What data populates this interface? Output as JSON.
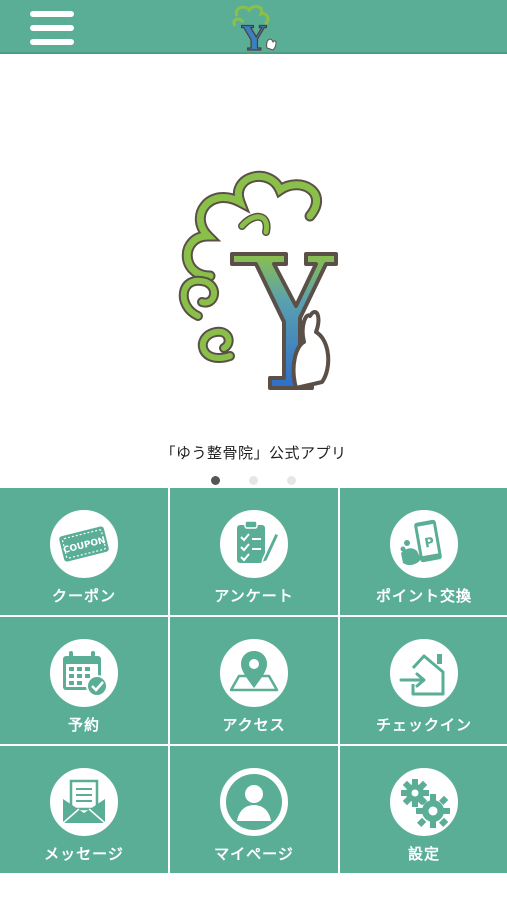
{
  "header": {
    "menu_icon": "hamburger-menu-icon",
    "logo_icon": "yu-logo-icon"
  },
  "hero": {
    "caption": "「ゆう整骨院」公式アプリ",
    "slides": 3,
    "active_slide": 1
  },
  "grid": {
    "tiles": [
      {
        "label": "クーポン",
        "icon": "coupon-icon"
      },
      {
        "label": "アンケート",
        "icon": "survey-clipboard-icon"
      },
      {
        "label": "ポイント交換",
        "icon": "point-exchange-phone-icon"
      },
      {
        "label": "予約",
        "icon": "calendar-reservation-icon"
      },
      {
        "label": "アクセス",
        "icon": "map-pin-icon"
      },
      {
        "label": "チェックイン",
        "icon": "checkin-house-icon"
      },
      {
        "label": "メッセージ",
        "icon": "message-envelope-icon"
      },
      {
        "label": "マイページ",
        "icon": "user-profile-icon"
      },
      {
        "label": "設定",
        "icon": "settings-gears-icon"
      }
    ]
  },
  "colors": {
    "brand_green": "#5aae96",
    "logo_green": "#8ac04a",
    "logo_blue": "#2f7fc0"
  },
  "logo_text": "Y"
}
